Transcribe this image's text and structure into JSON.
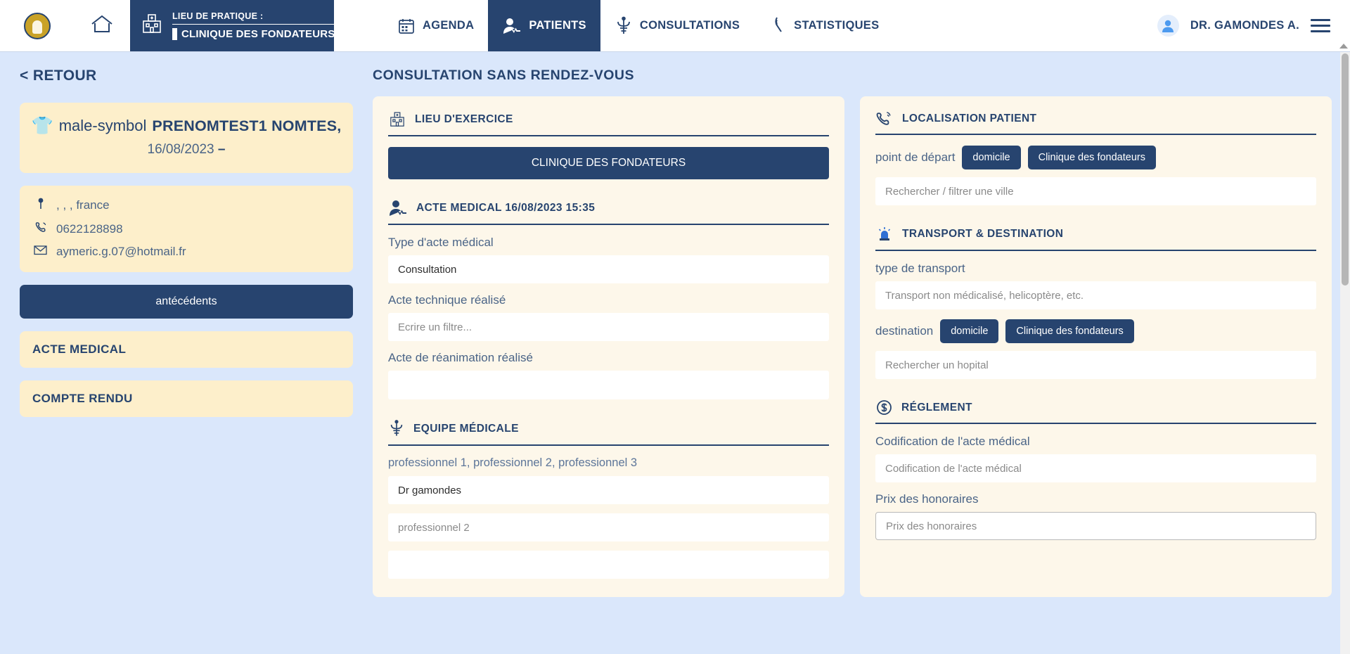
{
  "header": {
    "logo_icon": "crest-logo-icon",
    "home_icon": "home-icon",
    "practice": {
      "label": "LIEU DE PRATIQUE :",
      "value": "CLINIQUE DES FONDATEURS",
      "chevron_icon": "chevron-double-down-icon",
      "building_icon": "hospital-building-icon"
    },
    "tabs": [
      {
        "label": "AGENDA",
        "icon": "calendar-icon",
        "active": false
      },
      {
        "label": "PATIENTS",
        "icon": "patient-monitor-icon",
        "active": true
      },
      {
        "label": "CONSULTATIONS",
        "icon": "caduceus-icon",
        "active": false
      },
      {
        "label": "STATISTIQUES",
        "icon": "statistics-icon",
        "active": false
      }
    ],
    "user": {
      "name": "DR. GAMONDES A.",
      "avatar_icon": "user-avatar-icon",
      "menu_icon": "hamburger-menu-icon"
    }
  },
  "sidebar": {
    "back_label": "< RETOUR",
    "patient": {
      "avatar_icon": "patient-photo-icon",
      "gender_icon": "male-symbol",
      "name": "PRENOMTEST1 NOMTES,",
      "dob": "16/08/2023",
      "dob_suffix": "–"
    },
    "contact": {
      "address": ", , , france",
      "address_icon": "map-pin-icon",
      "phone": "0622128898",
      "phone_icon": "phone-icon",
      "email": "aymeric.g.07@hotmail.fr",
      "email_icon": "envelope-icon"
    },
    "antecedents_label": "antécédents",
    "sections": [
      {
        "label": "ACTE MEDICAL"
      },
      {
        "label": "COMPTE RENDU"
      }
    ]
  },
  "main": {
    "page_title": "CONSULTATION SANS RENDEZ-VOUS",
    "lieu_exercice": {
      "title": "LIEU D'EXERCICE",
      "icon": "hospital-building-icon",
      "selected": "CLINIQUE DES FONDATEURS"
    },
    "acte_medical": {
      "title": "ACTE MEDICAL 16/08/2023 15:35",
      "icon": "patient-monitor-icon",
      "type_label": "Type d'acte médical",
      "type_value": "Consultation",
      "technique_label": "Acte technique réalisé",
      "technique_placeholder": "Ecrire un filtre...",
      "reanimation_label": "Acte de réanimation réalisé",
      "reanimation_value": ""
    },
    "equipe_medicale": {
      "title": "EQUIPE MÉDICALE",
      "icon": "caduceus-icon",
      "hint": "professionnel 1, professionnel 2, professionnel 3",
      "pro1_value": "Dr gamondes",
      "pro2_placeholder": "professionnel 2"
    },
    "localisation": {
      "title": "LOCALISATION PATIENT",
      "icon": "phone-ring-icon",
      "depart_label": "point de départ",
      "chips": [
        "domicile",
        "Clinique des fondateurs"
      ],
      "city_placeholder": "Rechercher / filtrer une ville"
    },
    "transport": {
      "title": "TRANSPORT & DESTINATION",
      "icon": "siren-light-icon",
      "type_label": "type de transport",
      "type_placeholder": "Transport non médicalisé, helicoptère, etc.",
      "destination_label": "destination",
      "chips": [
        "domicile",
        "Clinique des fondateurs"
      ],
      "hospital_placeholder": "Rechercher un hopital"
    },
    "reglement": {
      "title": "RÉGLEMENT",
      "icon": "dollar-coin-icon",
      "codification_label": "Codification de l'acte médical",
      "codification_placeholder": "Codification de l'acte médical",
      "prix_label": "Prix des honoraires",
      "prix_placeholder": "Prix des honoraires"
    }
  },
  "colors": {
    "navy": "#27446f",
    "page_bg": "#dae7fb",
    "cream_card": "#fdefcb",
    "panel_bg": "#fdf7ea",
    "gold": "#c9a227"
  }
}
